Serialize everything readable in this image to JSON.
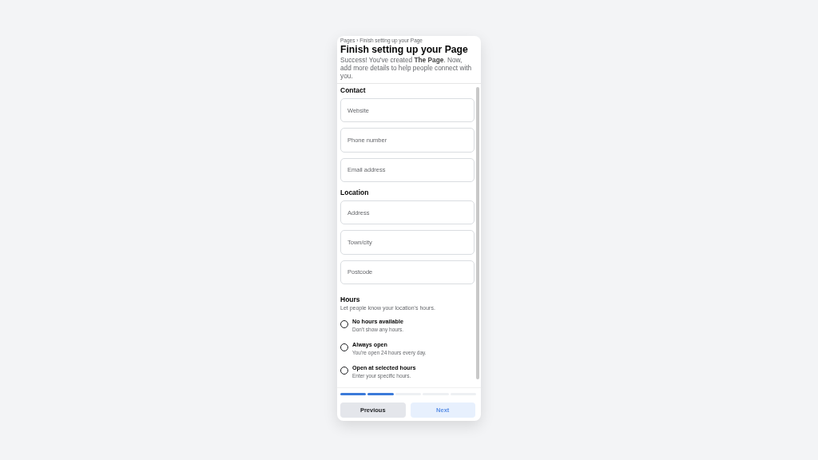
{
  "breadcrumb": "Pages › Finish setting up your Page",
  "title": "Finish setting up your Page",
  "description": "Success! You've created **The Page**. Now, add more details to help people connect with you.",
  "sections": [
    {
      "heading": "Contact",
      "fields": [
        {
          "placeholder": "Website"
        },
        {
          "placeholder": "Phone number"
        },
        {
          "placeholder": "Email address"
        }
      ]
    },
    {
      "heading": "Location",
      "fields": [
        {
          "placeholder": "Address"
        },
        {
          "placeholder": "Town/city"
        },
        {
          "placeholder": "Postcode"
        }
      ]
    }
  ],
  "hours": {
    "heading": "Hours",
    "subtitle": "Let people know your location's hours.",
    "options": [
      {
        "label": "No hours available",
        "hint": "Don't show any hours.",
        "selected": false
      },
      {
        "label": "Always open",
        "hint": "You're open 24 hours every day.",
        "selected": false
      },
      {
        "label": "Open at selected hours",
        "hint": "Enter your specific hours.",
        "selected": false
      }
    ]
  },
  "progress": [
    {
      "complete": true
    },
    {
      "complete": true
    },
    {
      "complete": false
    },
    {
      "complete": false
    },
    {
      "complete": false
    }
  ],
  "buttons": {
    "previous": "Previous",
    "next": "Next"
  }
}
